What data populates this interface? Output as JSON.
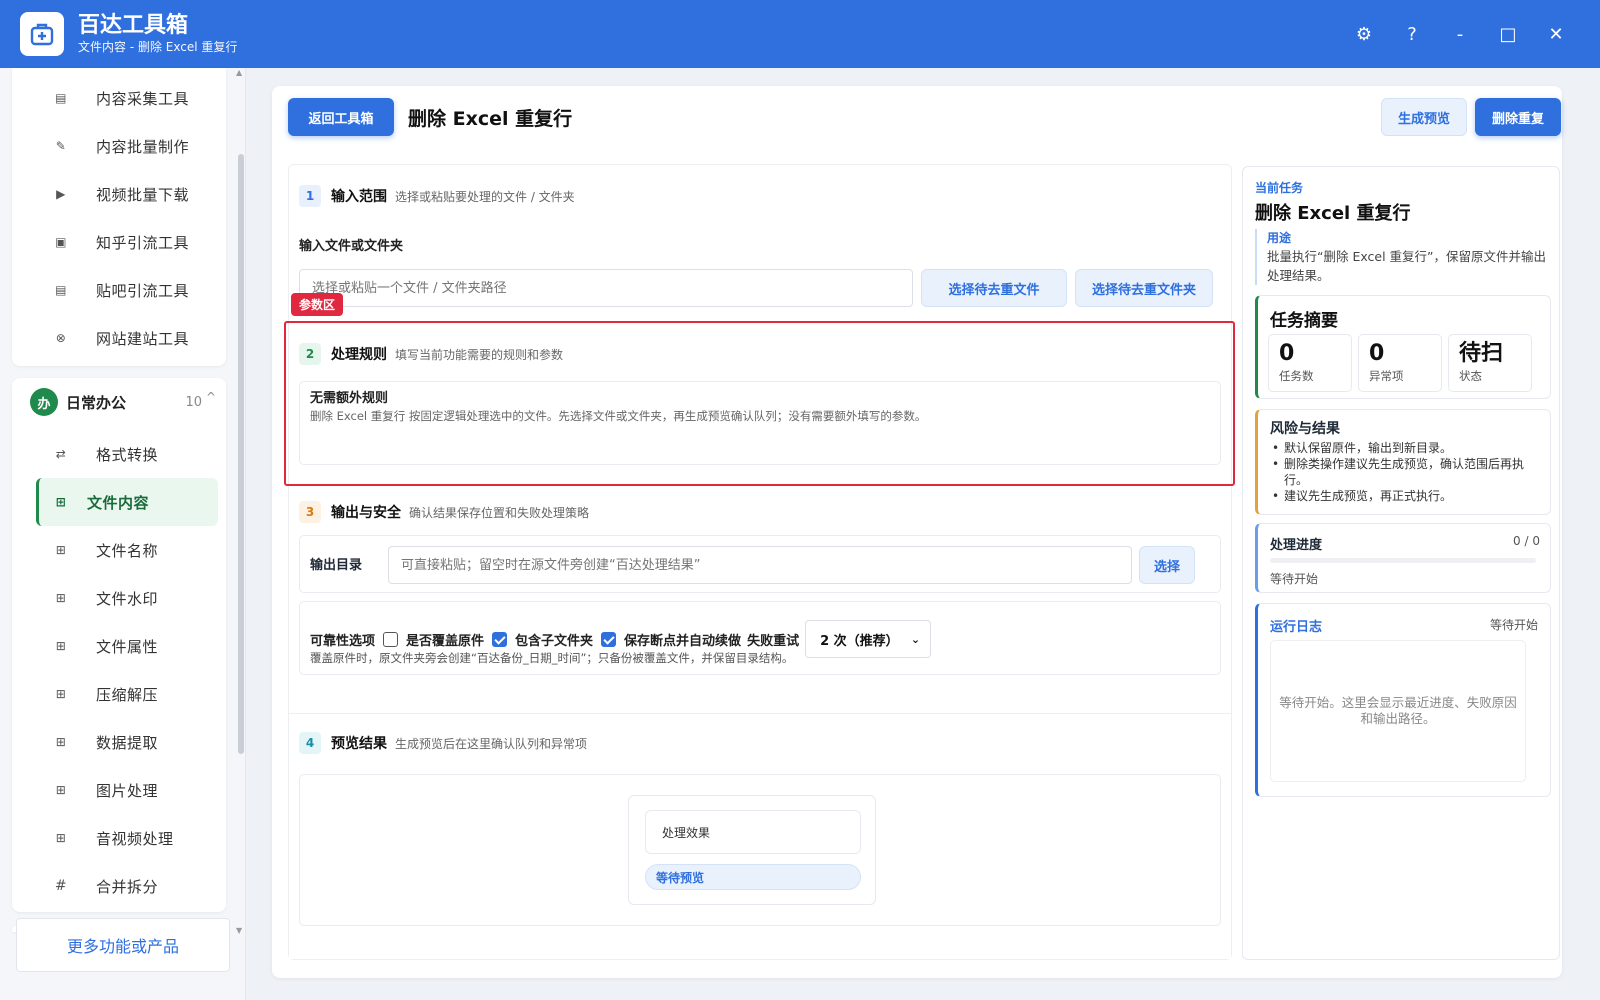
{
  "app": {
    "name": "百达工具箱",
    "subtitle": "文件内容 - 删除 Excel 重复行"
  },
  "window_controls": {
    "settings": "⚙",
    "help": "?",
    "minimize": "-",
    "maximize": "□",
    "close": "✕"
  },
  "sidebar": {
    "top_items": [
      {
        "label": "内容采集工具",
        "icon": "collect-icon"
      },
      {
        "label": "内容批量制作",
        "icon": "edit-icon"
      },
      {
        "label": "视频批量下载",
        "icon": "video-icon"
      },
      {
        "label": "知乎引流工具",
        "icon": "zhihu-icon"
      },
      {
        "label": "贴吧引流工具",
        "icon": "tieba-icon"
      },
      {
        "label": "网站建站工具",
        "icon": "web-icon"
      }
    ],
    "group": {
      "badge": "办",
      "title": "日常办公",
      "count": "10",
      "caret": "^"
    },
    "group_items": [
      {
        "label": "格式转换",
        "icon": "swap-icon"
      },
      {
        "label": "文件内容",
        "icon": "grid-icon",
        "active": true
      },
      {
        "label": "文件名称",
        "icon": "grid-icon"
      },
      {
        "label": "文件水印",
        "icon": "grid-icon"
      },
      {
        "label": "文件属性",
        "icon": "grid-icon"
      },
      {
        "label": "压缩解压",
        "icon": "grid-icon"
      },
      {
        "label": "数据提取",
        "icon": "grid-icon"
      },
      {
        "label": "图片处理",
        "icon": "grid-icon"
      },
      {
        "label": "音视频处理",
        "icon": "grid-icon"
      },
      {
        "label": "合并拆分",
        "icon": "hash-icon"
      }
    ],
    "more_label": "更多功能或产品"
  },
  "header": {
    "back_label": "返回工具箱",
    "title": "删除 Excel 重复行",
    "preview_label": "生成预览",
    "delete_label": "删除重复"
  },
  "sections": {
    "input": {
      "num": "1",
      "title": "输入范围",
      "desc": "选择或粘贴要处理的文件 / 文件夹",
      "field_label": "输入文件或文件夹",
      "placeholder": "选择或粘贴一个文件 / 文件夹路径",
      "pick_file": "选择待去重文件",
      "pick_folder": "选择待去重文件夹"
    },
    "param_tag": "参数区",
    "rules": {
      "num": "2",
      "title": "处理规则",
      "desc": "填写当前功能需要的规则和参数",
      "box_title": "无需额外规则",
      "box_text": "删除 Excel 重复行 按固定逻辑处理选中的文件。先选择文件或文件夹，再生成预览确认队列；没有需要额外填写的参数。"
    },
    "output": {
      "num": "3",
      "title": "输出与安全",
      "desc": "确认结果保存位置和失败处理策略",
      "dir_label": "输出目录",
      "dir_placeholder": "可直接粘贴；留空时在源文件旁创建“百达处理结果”",
      "dir_btn": "选择",
      "reliability_label": "可靠性选项",
      "overwrite_label": "是否覆盖原件",
      "overwrite_checked": false,
      "subfolders_label": "包含子文件夹",
      "subfolders_checked": true,
      "resume_label": "保存断点并自动续做",
      "resume_checked": true,
      "retry_label": "失败重试",
      "retry_value": "2 次（推荐）",
      "note": "覆盖原件时，原文件夹旁会创建“百达备份_日期_时间”；只备份被覆盖文件，并保留目录结构。"
    },
    "preview": {
      "num": "4",
      "title": "预览结果",
      "desc": "生成预览后在这里确认队列和异常项",
      "effect_label": "处理效果",
      "wait_label": "等待预览"
    }
  },
  "right_panel": {
    "kicker": "当前任务",
    "title": "删除 Excel 重复行",
    "usage_label": "用途",
    "usage_text": "批量执行“删除 Excel 重复行”，保留原文件并输出处理结果。",
    "summary_title": "任务摘要",
    "stats": [
      {
        "value": "0",
        "label": "任务数"
      },
      {
        "value": "0",
        "label": "异常项"
      },
      {
        "value": "待扫",
        "label": "状态"
      }
    ],
    "risk_title": "风险与结果",
    "risks": [
      "默认保留原件，输出到新目录。",
      "删除类操作建议先生成预览，确认范围后再执行。",
      "建议先生成预览，再正式执行。"
    ],
    "progress_title": "处理进度",
    "progress_count": "0 / 0",
    "progress_value": 0,
    "progress_status": "等待开始",
    "log_title": "运行日志",
    "log_state": "等待开始",
    "log_text": "等待开始。这里会显示最近进度、失败原因和输出路径。"
  },
  "colors": {
    "brand": "#2f6fde",
    "accent_green": "#1f8a4c",
    "highlight_red": "#e0283e"
  }
}
